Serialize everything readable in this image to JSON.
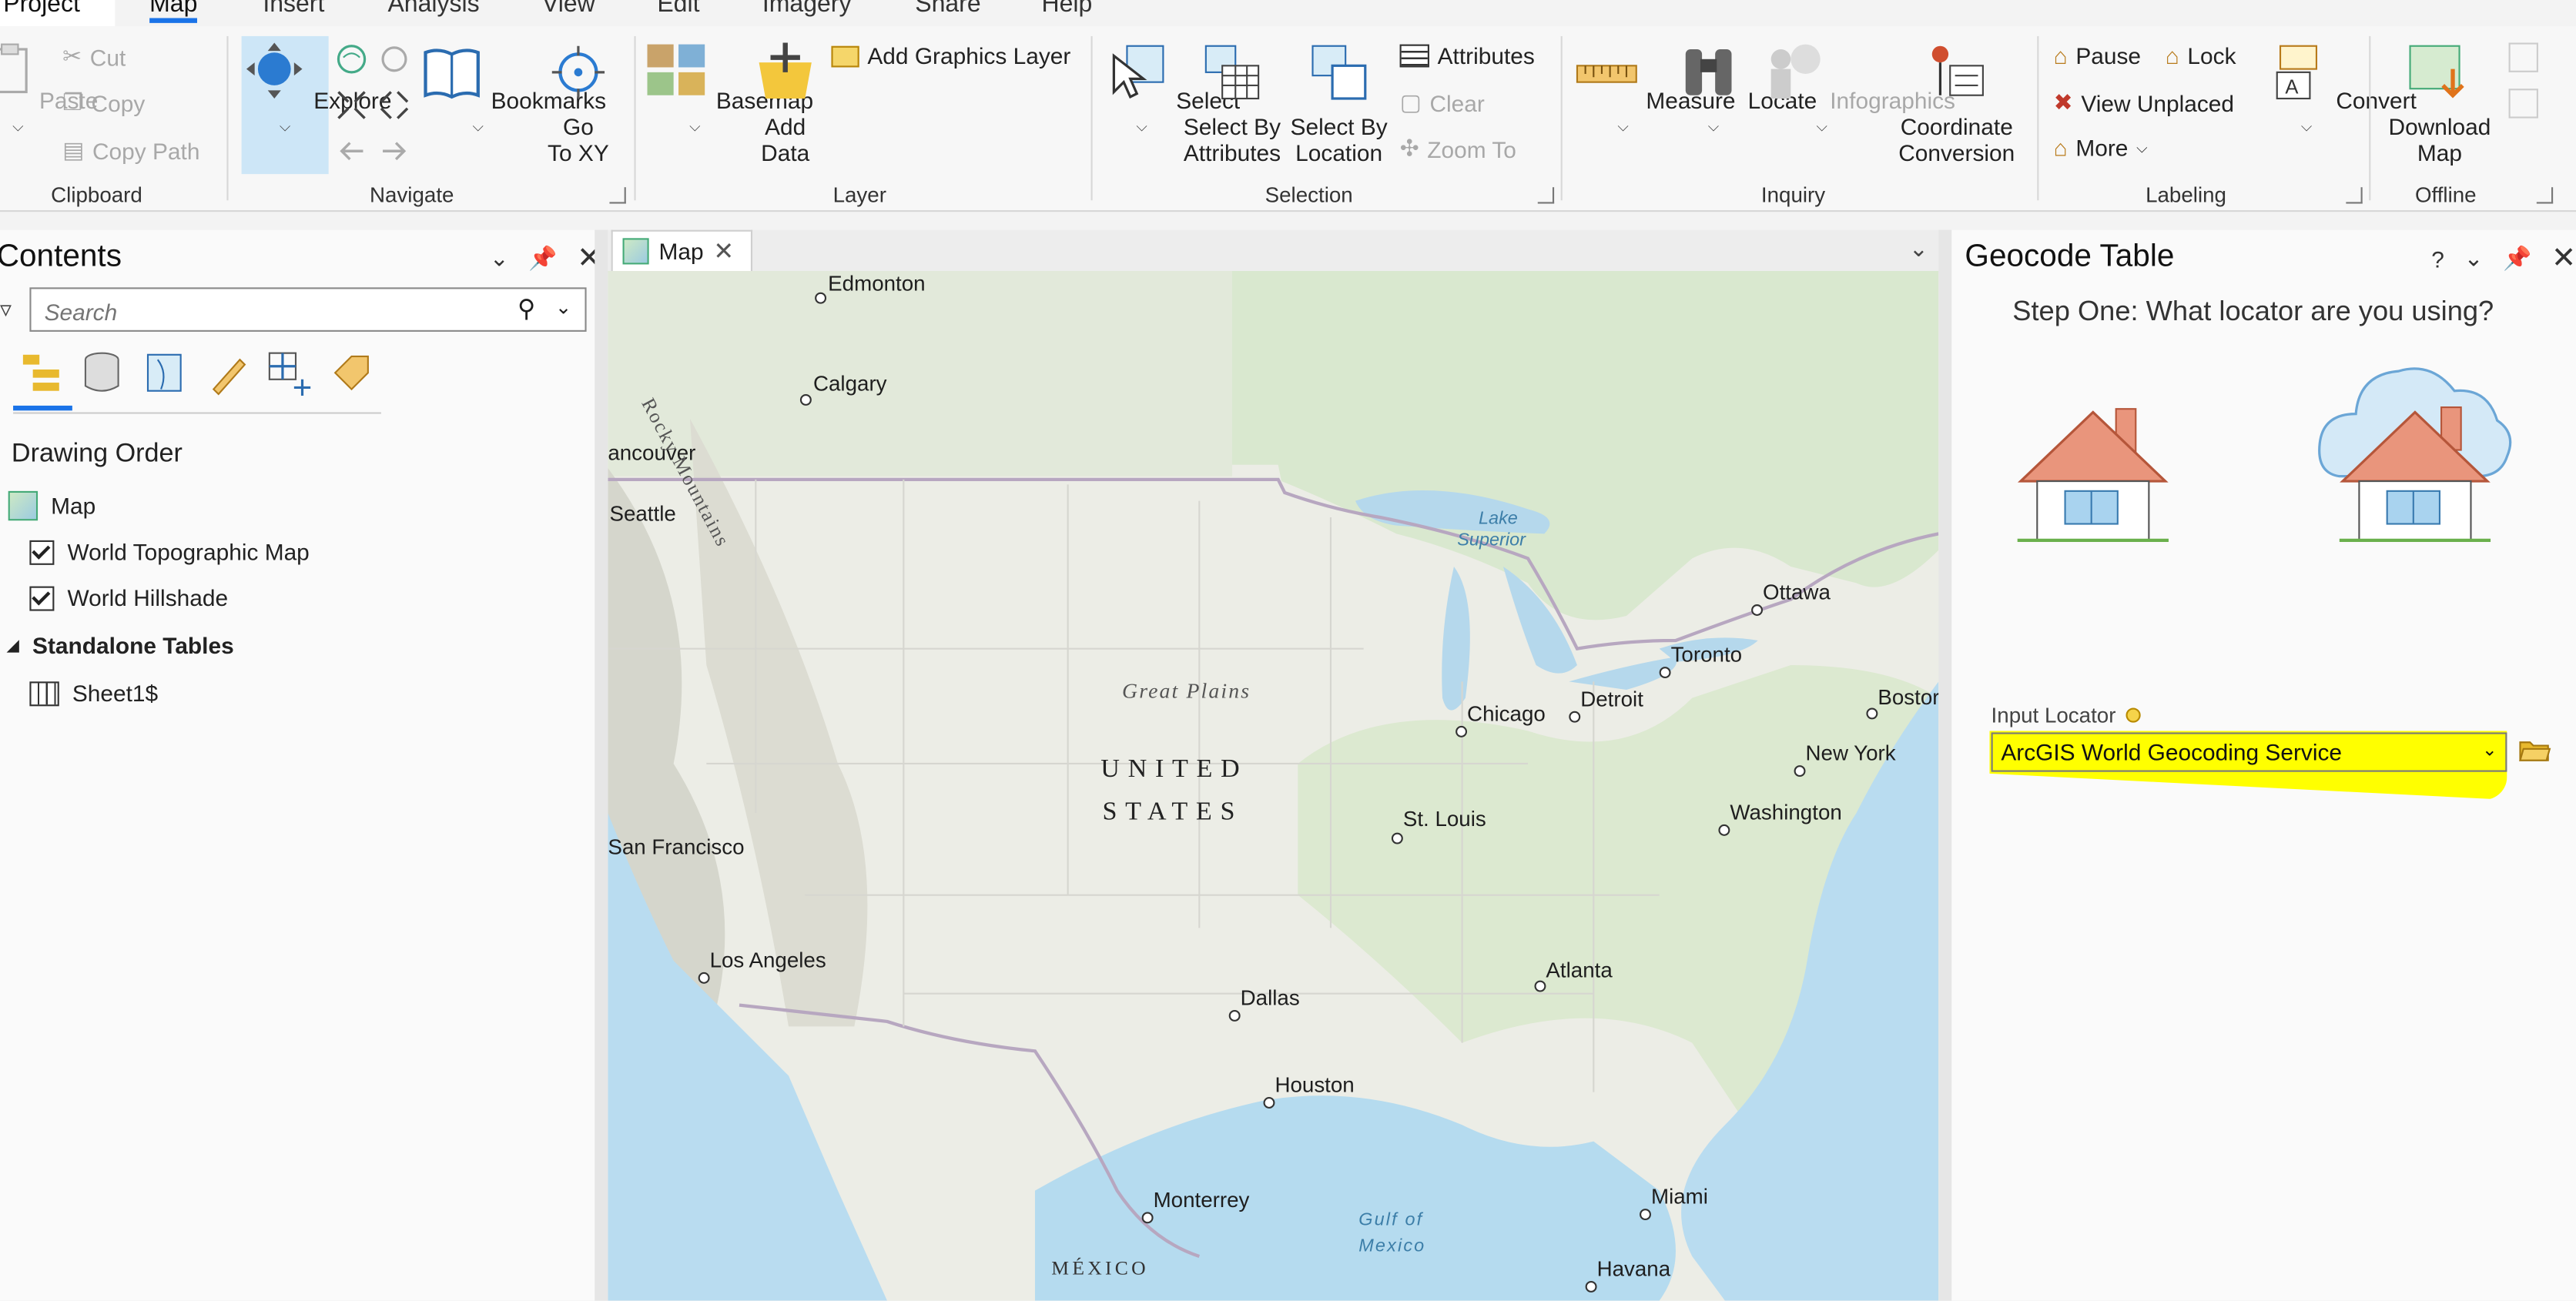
{
  "ribbon_tabs": [
    "Project",
    "Map",
    "Insert",
    "Analysis",
    "View",
    "Edit",
    "Imagery",
    "Share",
    "Help"
  ],
  "active_tab": "Map",
  "clipboard": {
    "paste": "Paste",
    "cut": "Cut",
    "copy": "Copy",
    "copy_path": "Copy Path",
    "group": "Clipboard"
  },
  "navigate": {
    "explore": "Explore",
    "bookmarks": "Bookmarks",
    "goto_1": "Go",
    "goto_2": "To XY",
    "group": "Navigate"
  },
  "layer": {
    "basemap": "Basemap",
    "add_data_1": "Add",
    "add_data_2": "Data",
    "add_graphics": "Add Graphics Layer",
    "group": "Layer"
  },
  "selection": {
    "select": "Select",
    "select_attr_1": "Select By",
    "select_attr_2": "Attributes",
    "select_loc_1": "Select By",
    "select_loc_2": "Location",
    "attributes": "Attributes",
    "clear": "Clear",
    "zoom_to": "Zoom To",
    "group": "Selection"
  },
  "inquiry": {
    "measure": "Measure",
    "locate": "Locate",
    "infographics": "Infographics",
    "coord_1": "Coordinate",
    "coord_2": "Conversion",
    "group": "Inquiry"
  },
  "labeling": {
    "pause": "Pause",
    "lock": "Lock",
    "view_unplaced": "View Unplaced",
    "more": "More",
    "convert": "Convert",
    "group": "Labeling"
  },
  "offline": {
    "download_1": "Download",
    "download_2": "Map",
    "group": "Offline"
  },
  "contents": {
    "title": "Contents",
    "search_placeholder": "Search",
    "drawing_order": "Drawing Order",
    "map": "Map",
    "layers": [
      "World Topographic Map",
      "World Hillshade"
    ],
    "standalone": "Standalone Tables",
    "table": "Sheet1$"
  },
  "map_tab": "Map",
  "map_labels": {
    "cities": [
      "Edmonton",
      "Calgary",
      "ancouver",
      "Seattle",
      "San Francisco",
      "Los Angeles",
      "Dallas",
      "Houston",
      "Monterrey",
      "St. Louis",
      "Chicago",
      "Detroit",
      "Toronto",
      "Ottawa",
      "Bostor",
      "New York",
      "Washington",
      "Atlanta",
      "Miami",
      "Havana"
    ],
    "rocky": "Rocky Mountains",
    "lake_1": "Lake",
    "lake_2": "Superior",
    "great_plains": "Great Plains",
    "country_1": "UNITED",
    "country_2": "STATES",
    "gulf_1": "Gulf of",
    "gulf_2": "Mexico",
    "mexico": "MÉXICO"
  },
  "geocode": {
    "title": "Geocode Table",
    "help": "?",
    "step": "Step One: What locator are you using?",
    "input_label": "Input Locator",
    "locator_value": "ArcGIS World Geocoding Service",
    "highlight_color": "#ffff00"
  }
}
